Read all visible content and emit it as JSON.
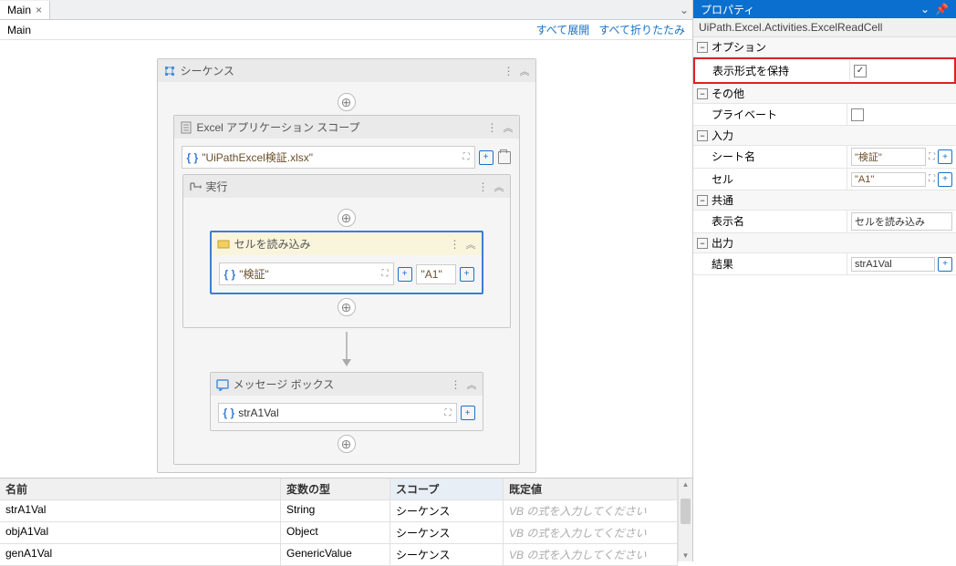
{
  "tab": {
    "title": "Main",
    "close": "×"
  },
  "breadcrumb": {
    "path": "Main",
    "expand_all": "すべて展開",
    "collapse_all": "すべて折りたたみ"
  },
  "seq": {
    "title": "シーケンス",
    "excel_scope": {
      "title": "Excel アプリケーション スコープ",
      "file": "\"UiPathExcel検証.xlsx\"",
      "do": {
        "title": "実行",
        "read_cell": {
          "title": "セルを読み込み",
          "sheet": "\"検証\"",
          "cell": "\"A1\""
        }
      },
      "msgbox": {
        "title": "メッセージ ボックス",
        "value": "strA1Val"
      }
    }
  },
  "vars": {
    "headers": {
      "name": "名前",
      "type": "変数の型",
      "scope": "スコープ",
      "default": "既定値"
    },
    "placeholder": "VB の式を入力してください",
    "rows": [
      {
        "name": "strA1Val",
        "type": "String",
        "scope": "シーケンス"
      },
      {
        "name": "objA1Val",
        "type": "Object",
        "scope": "シーケンス"
      },
      {
        "name": "genA1Val",
        "type": "GenericValue",
        "scope": "シーケンス"
      }
    ]
  },
  "props": {
    "title": "プロパティ",
    "type": "UiPath.Excel.Activities.ExcelReadCell",
    "sections": {
      "option": "オプション",
      "other": "その他",
      "input": "入力",
      "common": "共通",
      "output": "出力"
    },
    "fields": {
      "preserve_format": {
        "label": "表示形式を保持",
        "checked": true
      },
      "private": {
        "label": "プライベート",
        "checked": false
      },
      "sheet_name": {
        "label": "シート名",
        "value": "\"検証\""
      },
      "cell": {
        "label": "セル",
        "value": "\"A1\""
      },
      "display_name": {
        "label": "表示名",
        "value": "セルを読み込み"
      },
      "result": {
        "label": "結果",
        "value": "strA1Val"
      }
    }
  }
}
